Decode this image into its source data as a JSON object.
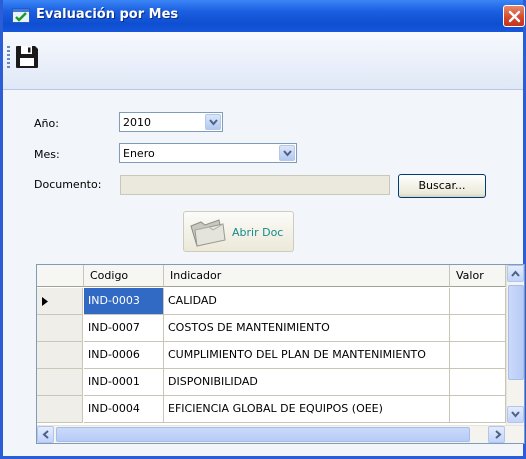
{
  "window": {
    "title": "Evaluación por Mes"
  },
  "form": {
    "anio_label": "Año:",
    "anio_value": "2010",
    "mes_label": "Mes:",
    "mes_value": "Enero",
    "documento_label": "Documento:",
    "documento_value": "",
    "buscar_label": "Buscar...",
    "abrir_doc_label": "Abrir Doc"
  },
  "grid": {
    "columns": [
      "Codigo",
      "Indicador",
      "Valor"
    ],
    "rows": [
      {
        "codigo": "IND-0003",
        "indicador": "CALIDAD",
        "valor": "",
        "selected": true
      },
      {
        "codigo": "IND-0007",
        "indicador": "COSTOS DE MANTENIMIENTO",
        "valor": ""
      },
      {
        "codigo": "IND-0006",
        "indicador": "CUMPLIMIENTO DEL PLAN DE MANTENIMIENTO",
        "valor": ""
      },
      {
        "codigo": "IND-0001",
        "indicador": "DISPONIBILIDAD",
        "valor": ""
      },
      {
        "codigo": "IND-0004",
        "indicador": "EFICIENCIA GLOBAL DE EQUIPOS (OEE)",
        "valor": ""
      }
    ]
  },
  "colors": {
    "titlebar": "#1b5fe0",
    "selection": "#316ac5",
    "abrir_text": "#168a8a"
  },
  "icons": {
    "title": "form-icon",
    "close": "close-icon",
    "save": "floppy-disk-icon",
    "abrir": "folder-icon",
    "row_pointer": "row-pointer-icon"
  }
}
